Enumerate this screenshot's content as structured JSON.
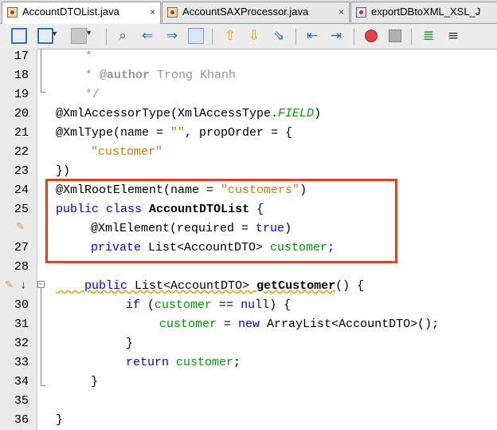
{
  "tabs": [
    {
      "label": "AccountDTOList.java",
      "close": "×",
      "active": true
    },
    {
      "label": "AccountSAXProcessor.java",
      "close": "×",
      "active": false
    },
    {
      "label": "exportDBtoXML_XSL_J",
      "close": "",
      "active": false
    }
  ],
  "toolbar": {
    "icons": [
      "last-edit-icon",
      "back-icon",
      "forward-icon",
      "find-icon",
      "find-previous-icon",
      "find-next-icon",
      "toggle-highlight-icon",
      "previous-bookmark-icon",
      "next-bookmark-icon",
      "toggle-bookmark-icon",
      "shift-left-icon",
      "shift-right-icon",
      "start-macro-icon",
      "stop-macro-icon",
      "comment-icon",
      "uncomment-icon"
    ]
  },
  "lines": [
    {
      "num": "17"
    },
    {
      "num": "18"
    },
    {
      "num": "19"
    },
    {
      "num": "20"
    },
    {
      "num": "21"
    },
    {
      "num": "22"
    },
    {
      "num": "23"
    },
    {
      "num": "24"
    },
    {
      "num": "25"
    },
    {
      "num": ""
    },
    {
      "num": "27"
    },
    {
      "num": "28"
    },
    {
      "num": ""
    },
    {
      "num": "30"
    },
    {
      "num": "31"
    },
    {
      "num": "32"
    },
    {
      "num": "33"
    },
    {
      "num": "34"
    },
    {
      "num": "35"
    },
    {
      "num": "36"
    }
  ],
  "code": {
    "l17": "     *",
    "l18_pre": "     * ",
    "l18_tag": "@author",
    "l18_rest": " Trong Khanh",
    "l19": "     */",
    "l20_a": "@XmlAccessorType(XmlAccessType.",
    "l20_b": "FIELD",
    "l20_c": ")",
    "l21_a": "@XmlType(name = ",
    "l21_b": "\"\"",
    "l21_c": ", propOrder = {",
    "l22": "\"customer\"",
    "l23": "})",
    "l24_a": "@XmlRootElement(name = ",
    "l24_b": "\"customers\"",
    "l24_c": ")",
    "l25_a": "public class",
    "l25_b": "AccountDTOList",
    "l25_c": " {",
    "l26_a": "@XmlElement(required = ",
    "l26_b": "true",
    "l26_c": ")",
    "l27_a": "private",
    "l27_b": " List<AccountDTO> ",
    "l27_c": "customer",
    "l27_d": ";",
    "l29_a": "public",
    "l29_b": " List<AccountDTO> ",
    "l29_c": "getCustomer",
    "l29_d": "() {",
    "l30_a": "if",
    "l30_b": " (",
    "l30_c": "customer",
    "l30_d": " == ",
    "l30_e": "null",
    "l30_f": ") {",
    "l31_a": "customer",
    "l31_b": " = ",
    "l31_c": "new",
    "l31_d": " ArrayList<AccountDTO>();",
    "l32": "}",
    "l33_a": "return",
    "l33_b": " ",
    "l33_c": "customer",
    "l33_d": ";",
    "l34": "}",
    "l36": "}"
  },
  "colors": {
    "keyword": "#0000e6",
    "string": "#ce7b00",
    "field": "#009900",
    "comment": "#969696",
    "highlight_box": "#e0431c"
  }
}
